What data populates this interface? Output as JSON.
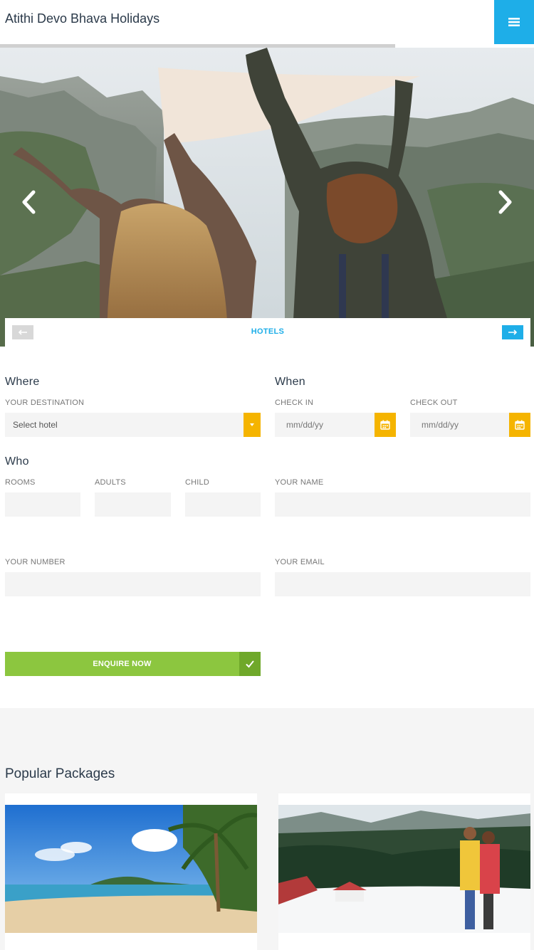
{
  "header": {
    "brand": "Atithi Devo Bhava Holidays",
    "menu_icon": "hamburger-icon"
  },
  "hero": {
    "progress": 0.74,
    "tab_label": "HOTELS",
    "prev_icon": "arrow-left-icon",
    "next_icon": "arrow-right-icon"
  },
  "form": {
    "where": {
      "title": "Where",
      "destination_label": "YOUR DESTINATION",
      "destination_value": "Select hotel"
    },
    "when": {
      "title": "When",
      "checkin_label": "CHECK IN",
      "checkin_placeholder": "mm/dd/yy",
      "checkout_label": "CHECK OUT",
      "checkout_placeholder": "mm/dd/yy"
    },
    "who": {
      "title": "Who",
      "rooms_label": "ROOMS",
      "adults_label": "ADULTS",
      "child_label": "CHILD"
    },
    "name_label": "YOUR NAME",
    "number_label": "YOUR NUMBER",
    "email_label": "YOUR EMAIL",
    "submit_label": "ENQUIRE NOW"
  },
  "packages": {
    "title": "Popular Packages"
  },
  "colors": {
    "accent": "#1eaee8",
    "calendar": "#f5b400",
    "submit": "#8cc63f"
  }
}
